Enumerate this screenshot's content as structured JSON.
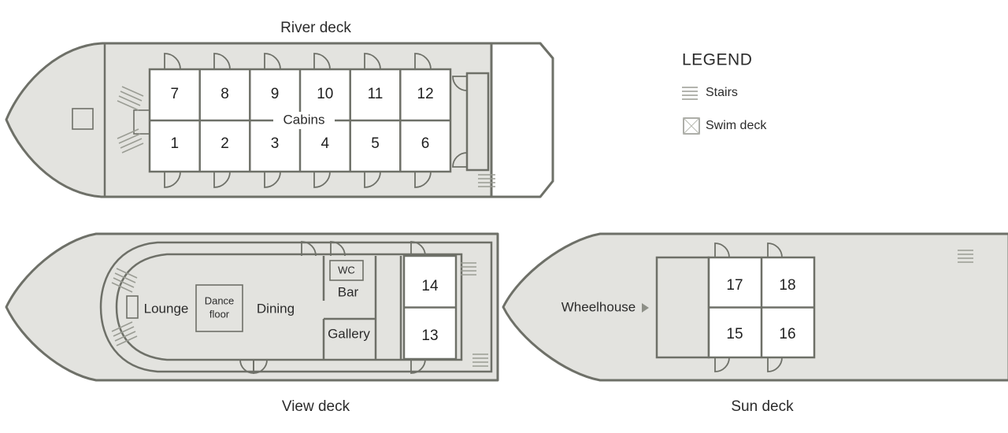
{
  "decks": {
    "river": {
      "title": "River deck",
      "cabins_label": "Cabins",
      "cabins_upper": [
        "7",
        "8",
        "9",
        "10",
        "11",
        "12"
      ],
      "cabins_lower": [
        "1",
        "2",
        "3",
        "4",
        "5",
        "6"
      ]
    },
    "view": {
      "title": "View deck",
      "rooms": {
        "lounge": "Lounge",
        "dance_floor_line1": "Dance",
        "dance_floor_line2": "floor",
        "dining": "Dining",
        "wc": "WC",
        "bar": "Bar",
        "gallery": "Gallery"
      },
      "cabins": [
        "14",
        "13"
      ]
    },
    "sun": {
      "title": "Sun deck",
      "wheelhouse_label": "Wheelhouse",
      "wheelhouse_arrow": "▸",
      "cabins_upper": [
        "17",
        "18"
      ],
      "cabins_lower": [
        "15",
        "16"
      ]
    }
  },
  "legend": {
    "title": "LEGEND",
    "items": [
      {
        "label": "Stairs",
        "icon": "stairs-icon"
      },
      {
        "label": "Swim deck",
        "icon": "swim-deck-icon"
      }
    ]
  },
  "colors": {
    "deck_fill": "#e3e3df",
    "outline": "#6e7068",
    "room_fill": "#ffffff",
    "text": "#2b2b2b",
    "stairs": "#9a9c94",
    "hatch": "#b9bbb2",
    "background": "#ffffff"
  }
}
